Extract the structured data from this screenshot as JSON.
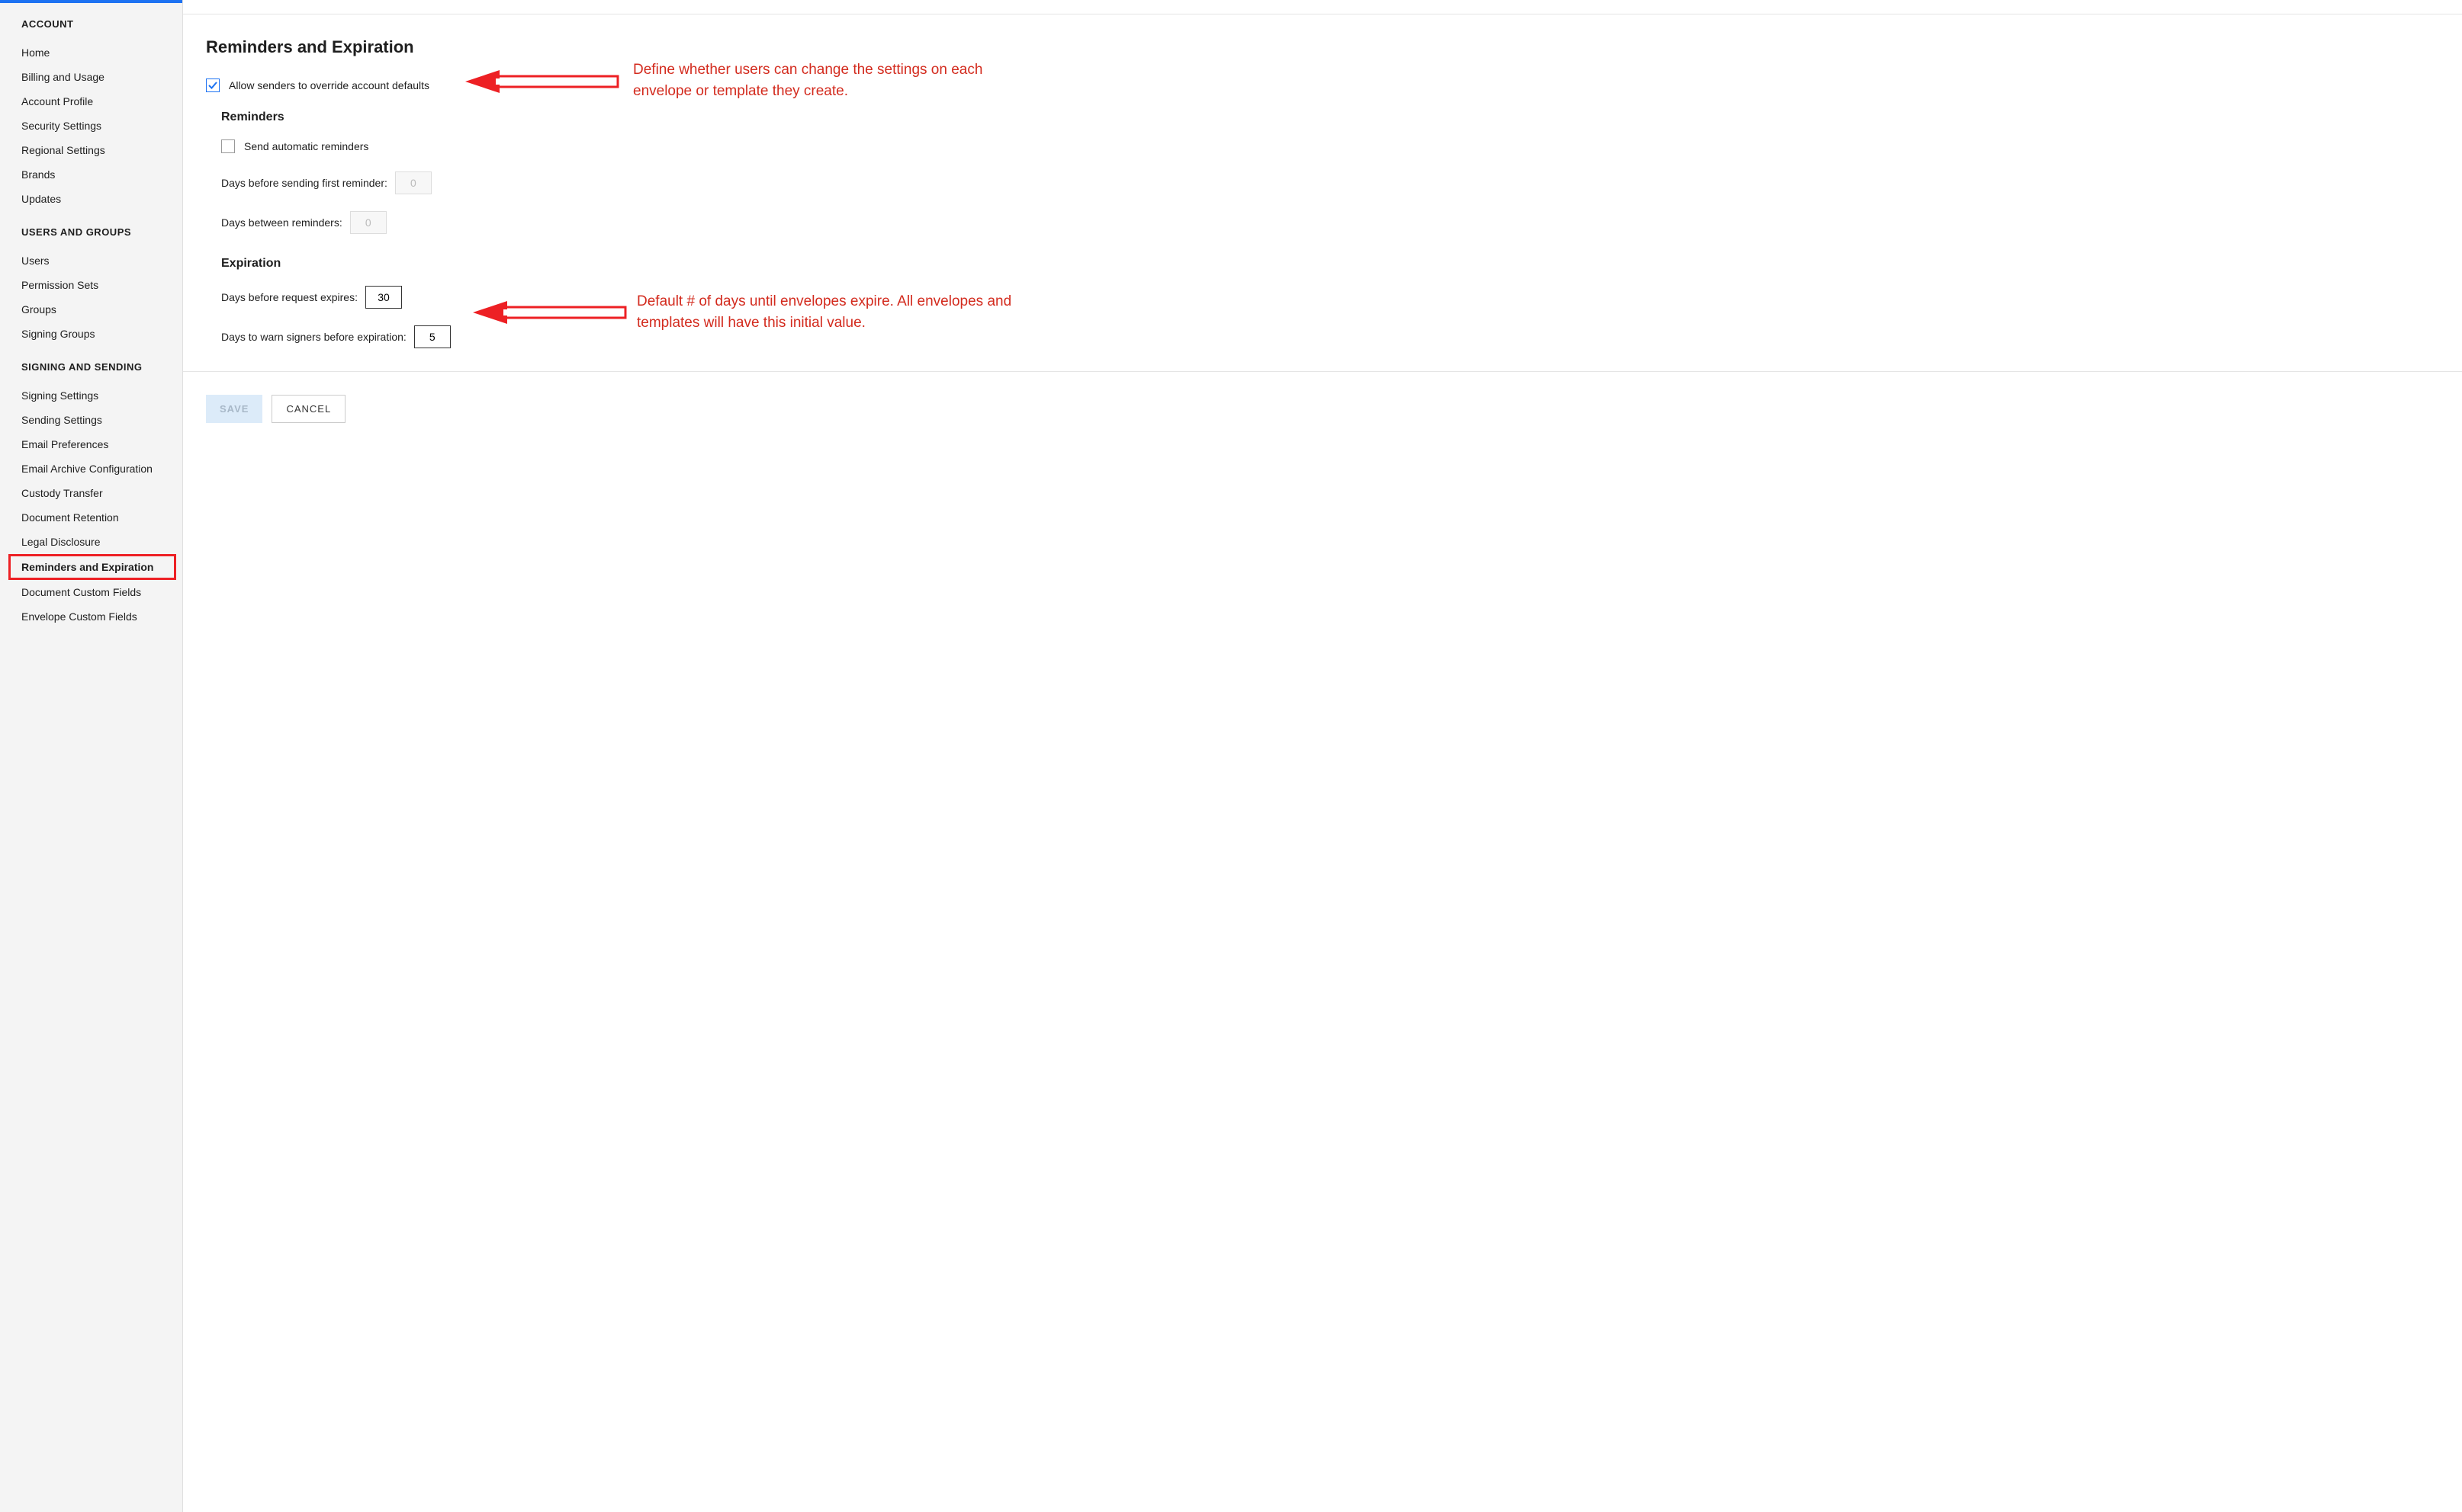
{
  "sidebar": {
    "groups": [
      {
        "heading": "ACCOUNT",
        "items": [
          "Home",
          "Billing and Usage",
          "Account Profile",
          "Security Settings",
          "Regional Settings",
          "Brands",
          "Updates"
        ]
      },
      {
        "heading": "USERS AND GROUPS",
        "items": [
          "Users",
          "Permission Sets",
          "Groups",
          "Signing Groups"
        ]
      },
      {
        "heading": "SIGNING AND SENDING",
        "items": [
          "Signing Settings",
          "Sending Settings",
          "Email Preferences",
          "Email Archive Configuration",
          "Custody Transfer",
          "Document Retention",
          "Legal Disclosure",
          "Reminders and Expiration",
          "Document Custom Fields",
          "Envelope Custom Fields"
        ]
      }
    ],
    "active_item": "Reminders and Expiration"
  },
  "page": {
    "title": "Reminders and Expiration",
    "allow_override": {
      "checked": true,
      "label": "Allow senders to override account defaults"
    },
    "reminders": {
      "title": "Reminders",
      "send_automatic": {
        "checked": false,
        "label": "Send automatic reminders"
      },
      "days_first_label": "Days before sending first reminder:",
      "days_first_value": "0",
      "days_between_label": "Days between reminders:",
      "days_between_value": "0"
    },
    "expiration": {
      "title": "Expiration",
      "days_before_label": "Days before request expires:",
      "days_before_value": "30",
      "days_warn_label": "Days to warn signers before expiration:",
      "days_warn_value": "5"
    },
    "buttons": {
      "save": "SAVE",
      "cancel": "CANCEL"
    }
  },
  "annotations": {
    "a1": "Define whether users can change the settings on each envelope or template they create.",
    "a2": "Default # of days until envelopes expire. All envelopes and templates will have this initial value."
  }
}
